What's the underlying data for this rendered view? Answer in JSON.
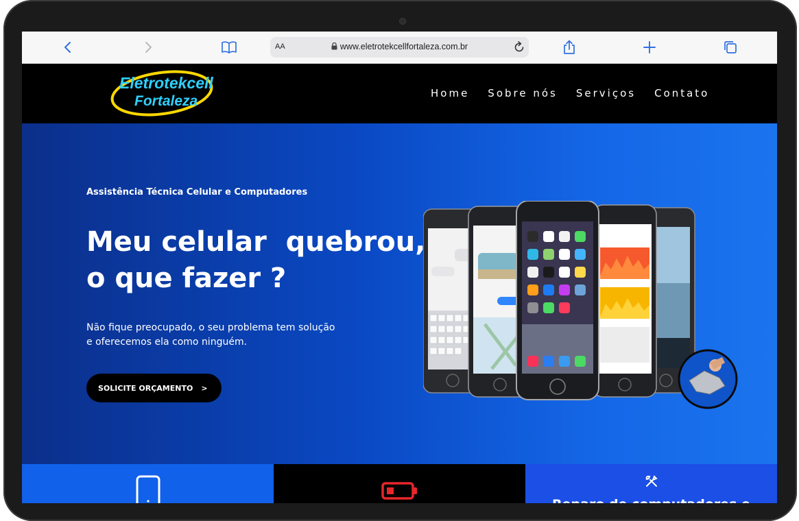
{
  "browser": {
    "text_size_label": "AA",
    "url": "www.eletrotekcellfortaleza.com.br"
  },
  "site": {
    "logo_line1": "Eletrotekcell",
    "logo_line2": "Fortaleza",
    "menu": [
      "Home",
      "Sobre nós",
      "Serviços",
      "Contato"
    ]
  },
  "hero": {
    "kicker": "Assistência Técnica Celular e Computadores",
    "headline_line1": "Meu celular  quebrou,",
    "headline_line2": "o que fazer ?",
    "description_line1": "Não fique preocupado, o seu problema tem solução",
    "description_line2": "e oferecemos ela como ninguém.",
    "cta_label": "SOLICITE ORÇAMENTO",
    "cta_arrow": ">"
  },
  "services": {
    "card3_title": "Reparo de computadores e"
  },
  "colors": {
    "hero_start": "#0b2f8a",
    "hero_end": "#1b74ee",
    "logo_text": "#2fd0ff",
    "logo_ring": "#ffd800",
    "battery_red": "#e8262b"
  },
  "icons": [
    "back-icon",
    "forward-icon",
    "book-icon",
    "lock-icon",
    "reload-icon",
    "share-icon",
    "plus-icon",
    "tabs-icon",
    "phone-icon",
    "battery-icon",
    "tools-icon"
  ]
}
